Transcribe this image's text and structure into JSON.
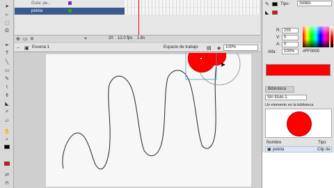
{
  "colors": {
    "fill": "#FF0000",
    "stroke": "#000000",
    "stage_bg": "#F7F7F7",
    "pasteboard_bg": "#CFCFCF"
  },
  "timeline": {
    "layers": [
      {
        "name": "Guía: pe...",
        "icon": "guide-icon"
      },
      {
        "name": "pelota",
        "icon": "layer-icon"
      }
    ],
    "frame_number": "20",
    "fps": "12.0 fps",
    "time": "1.6s"
  },
  "editbar": {
    "scene": "Escena 1",
    "workspace": "Espacio de trabajo",
    "zoom": "100%"
  },
  "color_panel": {
    "type_label": "Tipo:",
    "type_value": "Sólido",
    "r_label": "R:",
    "r_value": "255",
    "g_label": "V:",
    "g_value": "0",
    "b_label": "A:",
    "b_value": "0",
    "alpha_label": "Alfa:",
    "alpha_value": "100%",
    "hex": "#FF0000"
  },
  "library": {
    "tab": "Biblioteca",
    "doc": "Sin título-1",
    "count_text": "Un elemento en la biblioteca",
    "col_name": "Nombre",
    "col_type": "Tipo",
    "items": [
      {
        "name": "pelota",
        "type": "Clip de"
      }
    ]
  },
  "tools": [
    "arrow-icon",
    "subselect-icon",
    "free-transform-icon",
    "lasso-icon",
    "pen-icon",
    "text-icon",
    "line-icon",
    "rectangle-icon",
    "pencil-icon",
    "brush-icon",
    "ink-bottle-icon",
    "paint-bucket-icon",
    "eyedropper-icon",
    "eraser-icon",
    "hand-icon",
    "zoom-icon"
  ]
}
